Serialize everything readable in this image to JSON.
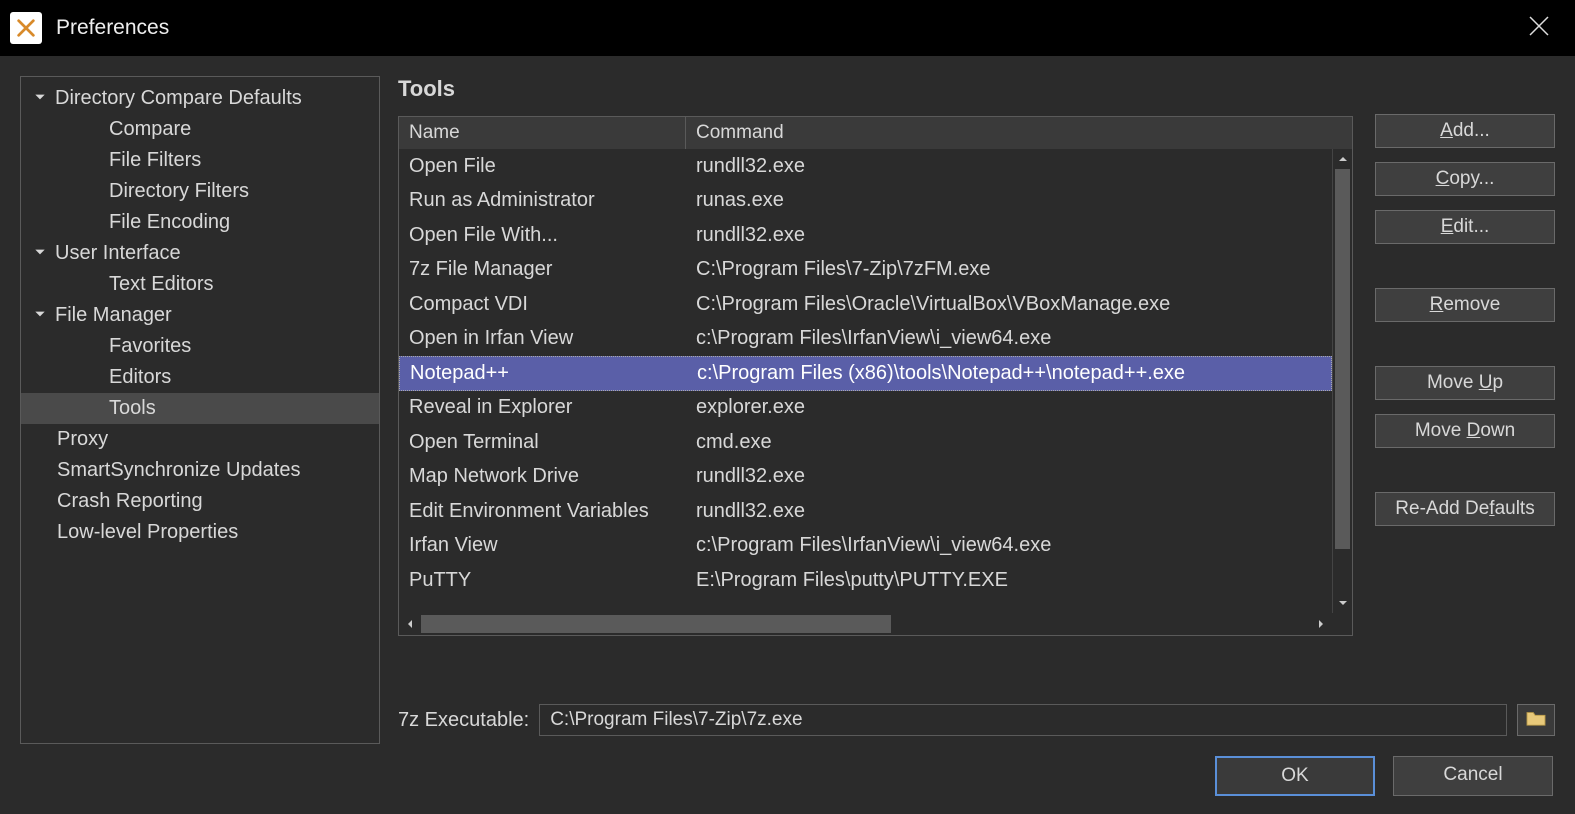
{
  "window": {
    "title": "Preferences"
  },
  "sidebar": {
    "groups": [
      {
        "label": "Directory Compare Defaults",
        "expanded": true,
        "items": [
          {
            "label": "Compare"
          },
          {
            "label": "File Filters"
          },
          {
            "label": "Directory Filters"
          },
          {
            "label": "File Encoding"
          }
        ]
      },
      {
        "label": "User Interface",
        "expanded": true,
        "items": [
          {
            "label": "Text Editors"
          }
        ]
      },
      {
        "label": "File Manager",
        "expanded": true,
        "items": [
          {
            "label": "Favorites"
          },
          {
            "label": "Editors"
          },
          {
            "label": "Tools",
            "selected": true
          }
        ]
      }
    ],
    "top_items": [
      {
        "label": "Proxy"
      },
      {
        "label": "SmartSynchronize Updates"
      },
      {
        "label": "Crash Reporting"
      },
      {
        "label": "Low-level Properties"
      }
    ]
  },
  "panel": {
    "title": "Tools",
    "columns": {
      "name": "Name",
      "command": "Command"
    },
    "rows": [
      {
        "name": "Open File",
        "command": "rundll32.exe"
      },
      {
        "name": "Run as Administrator",
        "command": "runas.exe"
      },
      {
        "name": "Open File With...",
        "command": "rundll32.exe"
      },
      {
        "name": "7z File Manager",
        "command": "C:\\Program Files\\7-Zip\\7zFM.exe"
      },
      {
        "name": "Compact VDI",
        "command": "C:\\Program Files\\Oracle\\VirtualBox\\VBoxManage.exe"
      },
      {
        "name": "Open in Irfan View",
        "command": "c:\\Program Files\\IrfanView\\i_view64.exe"
      },
      {
        "name": "Notepad++",
        "command": "c:\\Program Files (x86)\\tools\\Notepad++\\notepad++.exe",
        "selected": true
      },
      {
        "name": "Reveal in Explorer",
        "command": "explorer.exe"
      },
      {
        "name": "Open Terminal",
        "command": "cmd.exe"
      },
      {
        "name": "Map Network Drive",
        "command": "rundll32.exe"
      },
      {
        "name": "Edit Environment Variables",
        "command": "rundll32.exe"
      },
      {
        "name": "Irfan View",
        "command": "c:\\Program Files\\IrfanView\\i_view64.exe"
      },
      {
        "name": "PuTTY",
        "command": "E:\\Program Files\\putty\\PUTTY.EXE"
      }
    ]
  },
  "buttons": {
    "add_pre": "",
    "add_mn": "A",
    "add_post": "dd...",
    "copy_pre": "",
    "copy_mn": "C",
    "copy_post": "opy...",
    "edit_pre": "",
    "edit_mn": "E",
    "edit_post": "dit...",
    "remove_pre": "",
    "remove_mn": "R",
    "remove_post": "emove",
    "moveup_pre": "Move ",
    "moveup_mn": "U",
    "moveup_post": "p",
    "movedown_pre": "Move ",
    "movedown_mn": "D",
    "movedown_post": "own",
    "readd_pre": "Re-Add De",
    "readd_mn": "f",
    "readd_post": "aults"
  },
  "exec": {
    "label": "7z Executable:",
    "value": "C:\\Program Files\\7-Zip\\7z.exe"
  },
  "footer": {
    "ok": "OK",
    "cancel": "Cancel"
  }
}
